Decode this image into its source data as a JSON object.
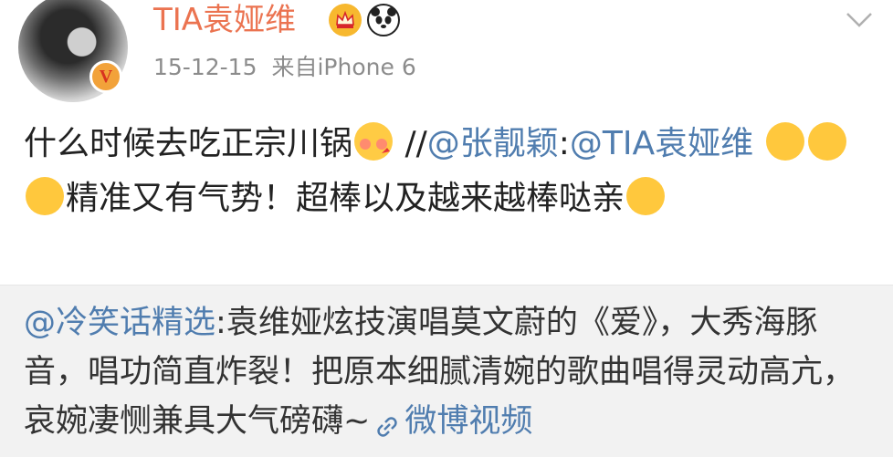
{
  "post": {
    "username": "TIA袁娅维",
    "date": "15-12-15",
    "source": "来自iPhone 6",
    "badges": [
      "crown-icon",
      "panda-icon"
    ],
    "verified_badge": "V",
    "text_part1": "什么时候去吃正宗川锅",
    "text_separator": " //",
    "mention1": "@张靓颖",
    "colon1": ":",
    "mention2": "@TIA袁娅维",
    "text_part2": "精准又有气势！超棒以及越来越棒哒亲",
    "colors": {
      "username": "#eb7350",
      "mention": "#507daf",
      "meta": "#8c8c8c"
    }
  },
  "repost": {
    "mention": "@冷笑话精选",
    "colon": ":",
    "text": "袁维娅炫技演唱莫文蔚的《爱》，大秀海豚音，唱功简直炸裂！把原本细腻清婉的歌曲唱得灵动高亢，哀婉凄恻兼具大气磅礴~",
    "link_label": "微博视频"
  }
}
